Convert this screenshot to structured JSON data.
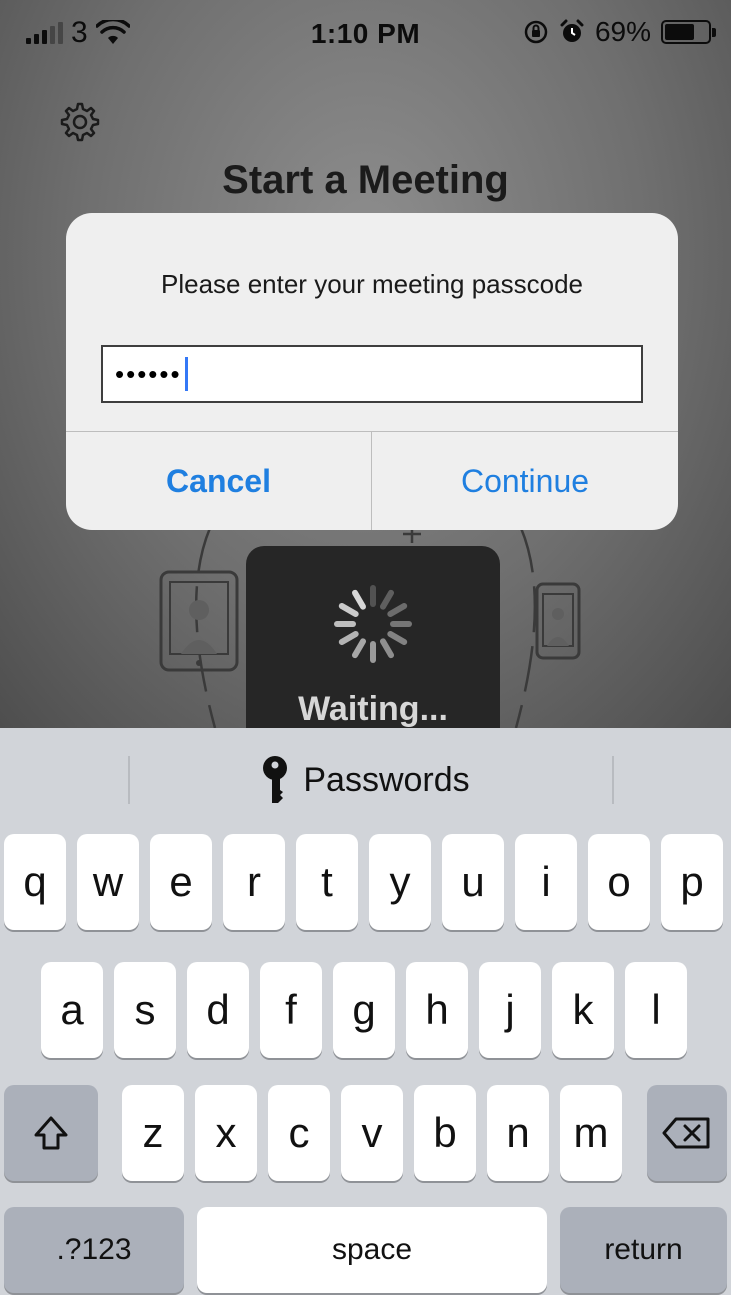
{
  "status_bar": {
    "carrier": "3",
    "time": "1:10 PM",
    "battery_percent": "69%",
    "battery_level": 0.69,
    "icons": [
      "signal-icon",
      "wifi-icon",
      "orientation-lock-icon",
      "alarm-icon",
      "battery-icon"
    ]
  },
  "app": {
    "title": "Start a Meeting",
    "settings_icon": "gear-icon",
    "waiting_text": "Waiting..."
  },
  "dialog": {
    "message": "Please enter your meeting passcode",
    "passcode_value": "••••••",
    "cancel_label": "Cancel",
    "continue_label": "Continue",
    "accent_color": "#1f7fe0"
  },
  "keyboard": {
    "suggestion": "Passwords",
    "suggestion_icon": "key-icon",
    "row1": [
      "q",
      "w",
      "e",
      "r",
      "t",
      "y",
      "u",
      "i",
      "o",
      "p"
    ],
    "row2": [
      "a",
      "s",
      "d",
      "f",
      "g",
      "h",
      "j",
      "k",
      "l"
    ],
    "row3": [
      "z",
      "x",
      "c",
      "v",
      "b",
      "n",
      "m"
    ],
    "numbers_label": ".?123",
    "space_label": "space",
    "return_label": "return"
  }
}
